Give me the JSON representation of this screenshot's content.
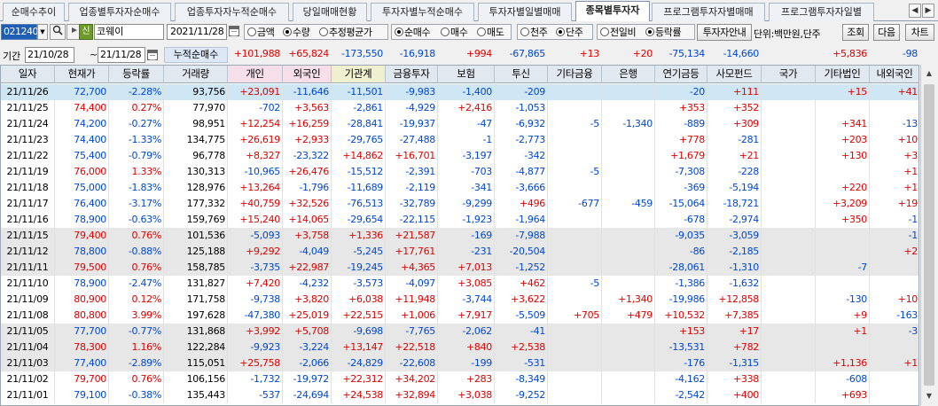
{
  "tabs": [
    {
      "label": "순매수추이",
      "active": false
    },
    {
      "label": "업종별투자자순매수",
      "active": false
    },
    {
      "label": "업종투자자누적순매수",
      "active": false
    },
    {
      "label": "당일매매현황",
      "active": false
    },
    {
      "label": "투자자별누적순매수",
      "active": false
    },
    {
      "label": "투자자별일별매매",
      "active": false
    },
    {
      "label": "종목별투자자",
      "active": true
    },
    {
      "label": "프로그램투자자별매매",
      "active": false
    },
    {
      "label": "프로그램투자자일별",
      "active": false
    }
  ],
  "tab_nav": {
    "prev": "◀",
    "next": "▶"
  },
  "toolbar": {
    "stock_code": "021240",
    "new_badge": "신",
    "stock_name": "코웨이",
    "date": "2021/11/28",
    "unit_radios": [
      {
        "label": "금액",
        "selected": false
      },
      {
        "label": "수량",
        "selected": true
      },
      {
        "label": "추정평균가",
        "selected": false
      }
    ],
    "trade_radios": [
      {
        "label": "순매수",
        "selected": true
      },
      {
        "label": "매수",
        "selected": false
      },
      {
        "label": "매도",
        "selected": false
      }
    ],
    "share_radios": [
      {
        "label": "천주",
        "selected": false
      },
      {
        "label": "단주",
        "selected": true
      }
    ],
    "compare_radios": [
      {
        "label": "전일비",
        "selected": false
      },
      {
        "label": "등락률",
        "selected": true
      }
    ],
    "investor_info_btn": "투자자안내",
    "unit_text": "단위:백만원,단주",
    "query_btn": "조회",
    "next_btn": "다음",
    "chart_btn": "차트"
  },
  "summary": {
    "period_label": "기간",
    "start_date": "21/10/28",
    "tilde": "~",
    "end_date": "21/11/28",
    "cumulative_label": "누적순매수",
    "values": [
      "+101,988",
      "+65,824",
      "-173,550",
      "-16,918",
      "+994",
      "-67,865",
      "+13",
      "+20",
      "-75,134",
      "-14,660",
      "",
      "+5,836",
      "-98"
    ]
  },
  "headers": [
    "일자",
    "현재가",
    "등락률",
    "거래량",
    "개인",
    "외국인",
    "기관계",
    "금융투자",
    "보험",
    "투신",
    "기타금융",
    "은행",
    "연기금등",
    "사모펀드",
    "국가",
    "기타법인",
    "내외국인"
  ],
  "rows": [
    [
      "21/11/26",
      "72,700",
      "-2.28%",
      "93,756",
      "+23,091",
      "-11,646",
      "-11,501",
      "-9,983",
      "-1,400",
      "-209",
      "",
      "",
      "-20",
      "+111",
      "",
      "+15",
      "+41"
    ],
    [
      "21/11/25",
      "74,400",
      "0.27%",
      "77,970",
      "-702",
      "+3,563",
      "-2,861",
      "-4,929",
      "+2,416",
      "-1,053",
      "",
      "",
      "+353",
      "+352",
      "",
      "",
      ""
    ],
    [
      "21/11/24",
      "74,200",
      "-0.27%",
      "98,951",
      "+12,254",
      "+16,259",
      "-28,841",
      "-19,937",
      "-47",
      "-6,932",
      "-5",
      "-1,340",
      "-889",
      "+309",
      "",
      "+341",
      "-13"
    ],
    [
      "21/11/23",
      "74,400",
      "-1.33%",
      "134,775",
      "+26,619",
      "+2,933",
      "-29,765",
      "-27,488",
      "-1",
      "-2,773",
      "",
      "",
      "+778",
      "-281",
      "",
      "+203",
      "+10"
    ],
    [
      "21/11/22",
      "75,400",
      "-0.79%",
      "96,778",
      "+8,327",
      "-23,322",
      "+14,862",
      "+16,701",
      "-3,197",
      "-342",
      "",
      "",
      "+1,679",
      "+21",
      "",
      "+130",
      "+3"
    ],
    [
      "21/11/19",
      "76,000",
      "1.33%",
      "130,313",
      "-10,965",
      "+26,476",
      "-15,512",
      "-2,391",
      "-703",
      "-4,877",
      "-5",
      "",
      "-7,308",
      "-228",
      "",
      "",
      "+1"
    ],
    [
      "21/11/18",
      "75,000",
      "-1.83%",
      "128,976",
      "+13,264",
      "-1,796",
      "-11,689",
      "-2,119",
      "-341",
      "-3,666",
      "",
      "",
      "-369",
      "-5,194",
      "",
      "+220",
      "+1"
    ],
    [
      "21/11/17",
      "76,400",
      "-3.17%",
      "177,332",
      "+40,759",
      "+32,526",
      "-76,513",
      "-32,789",
      "-9,299",
      "+496",
      "-677",
      "-459",
      "-15,064",
      "-18,721",
      "",
      "+3,209",
      "+19"
    ],
    [
      "21/11/16",
      "78,900",
      "-0.63%",
      "159,769",
      "+15,240",
      "+14,065",
      "-29,654",
      "-22,115",
      "-1,923",
      "-1,964",
      "",
      "",
      "-678",
      "-2,974",
      "",
      "+350",
      "-1"
    ],
    [
      "21/11/15",
      "79,400",
      "0.76%",
      "101,536",
      "-5,093",
      "+3,758",
      "+1,336",
      "+21,587",
      "-169",
      "-7,988",
      "",
      "",
      "-9,035",
      "-3,059",
      "",
      "",
      "-1"
    ],
    [
      "21/11/12",
      "78,800",
      "-0.88%",
      "125,188",
      "+9,292",
      "-4,049",
      "-5,245",
      "+17,761",
      "-231",
      "-20,504",
      "",
      "",
      "-86",
      "-2,185",
      "",
      "",
      "+2"
    ],
    [
      "21/11/11",
      "79,500",
      "0.76%",
      "158,785",
      "-3,735",
      "+22,987",
      "-19,245",
      "+4,365",
      "+7,013",
      "-1,252",
      "",
      "",
      "-28,061",
      "-1,310",
      "",
      "-7",
      ""
    ],
    [
      "21/11/10",
      "78,900",
      "-2.47%",
      "131,827",
      "+7,420",
      "-4,232",
      "-3,573",
      "-4,097",
      "+3,085",
      "+462",
      "-5",
      "",
      "-1,386",
      "-1,632",
      "",
      "",
      ""
    ],
    [
      "21/11/09",
      "80,900",
      "0.12%",
      "171,758",
      "-9,738",
      "+3,820",
      "+6,038",
      "+11,948",
      "-3,744",
      "+3,622",
      "",
      "+1,340",
      "-19,986",
      "+12,858",
      "",
      "-130",
      "+10"
    ],
    [
      "21/11/08",
      "80,800",
      "3.99%",
      "197,628",
      "-47,380",
      "+25,019",
      "+22,515",
      "+1,006",
      "+7,917",
      "-5,509",
      "+705",
      "+479",
      "+10,532",
      "+7,385",
      "",
      "+9",
      "-163"
    ],
    [
      "21/11/05",
      "77,700",
      "-0.77%",
      "131,868",
      "+3,992",
      "+5,708",
      "-9,698",
      "-7,765",
      "-2,062",
      "-41",
      "",
      "",
      "+153",
      "+17",
      "",
      "+1",
      "-3"
    ],
    [
      "21/11/04",
      "78,300",
      "1.16%",
      "122,284",
      "-9,923",
      "-3,224",
      "+13,147",
      "+22,518",
      "+840",
      "+2,538",
      "",
      "",
      "-13,531",
      "+782",
      "",
      "",
      ""
    ],
    [
      "21/11/03",
      "77,400",
      "-2.89%",
      "115,051",
      "+25,758",
      "-2,066",
      "-24,829",
      "-22,608",
      "-199",
      "-531",
      "",
      "",
      "-176",
      "-1,315",
      "",
      "+1,136",
      "+1"
    ],
    [
      "21/11/02",
      "79,700",
      "0.76%",
      "106,156",
      "-1,732",
      "-19,972",
      "+22,312",
      "+34,202",
      "+283",
      "-8,349",
      "",
      "",
      "-4,162",
      "+338",
      "",
      "-608",
      ""
    ],
    [
      "21/11/01",
      "79,100",
      "-0.38%",
      "135,443",
      "-537",
      "-24,694",
      "+24,538",
      "+32,894",
      "+3,038",
      "-9,252",
      "",
      "",
      "-2,542",
      "+400",
      "",
      "+693",
      ""
    ]
  ],
  "row_bg": [
    "sel",
    "",
    "",
    "",
    "",
    "",
    "",
    "",
    "",
    "gray",
    "gray",
    "gray",
    "",
    "",
    "",
    "gray",
    "gray",
    "gray",
    "",
    ""
  ],
  "colors": {
    "up": "#e00000",
    "down": "#0047d6",
    "selected_row": "#cfe6f5",
    "shaded_row": "#e7e7e7"
  },
  "icons": {
    "search": "search-icon",
    "calendar": "calendar-icon",
    "dropdown": "chevron-down-icon"
  }
}
